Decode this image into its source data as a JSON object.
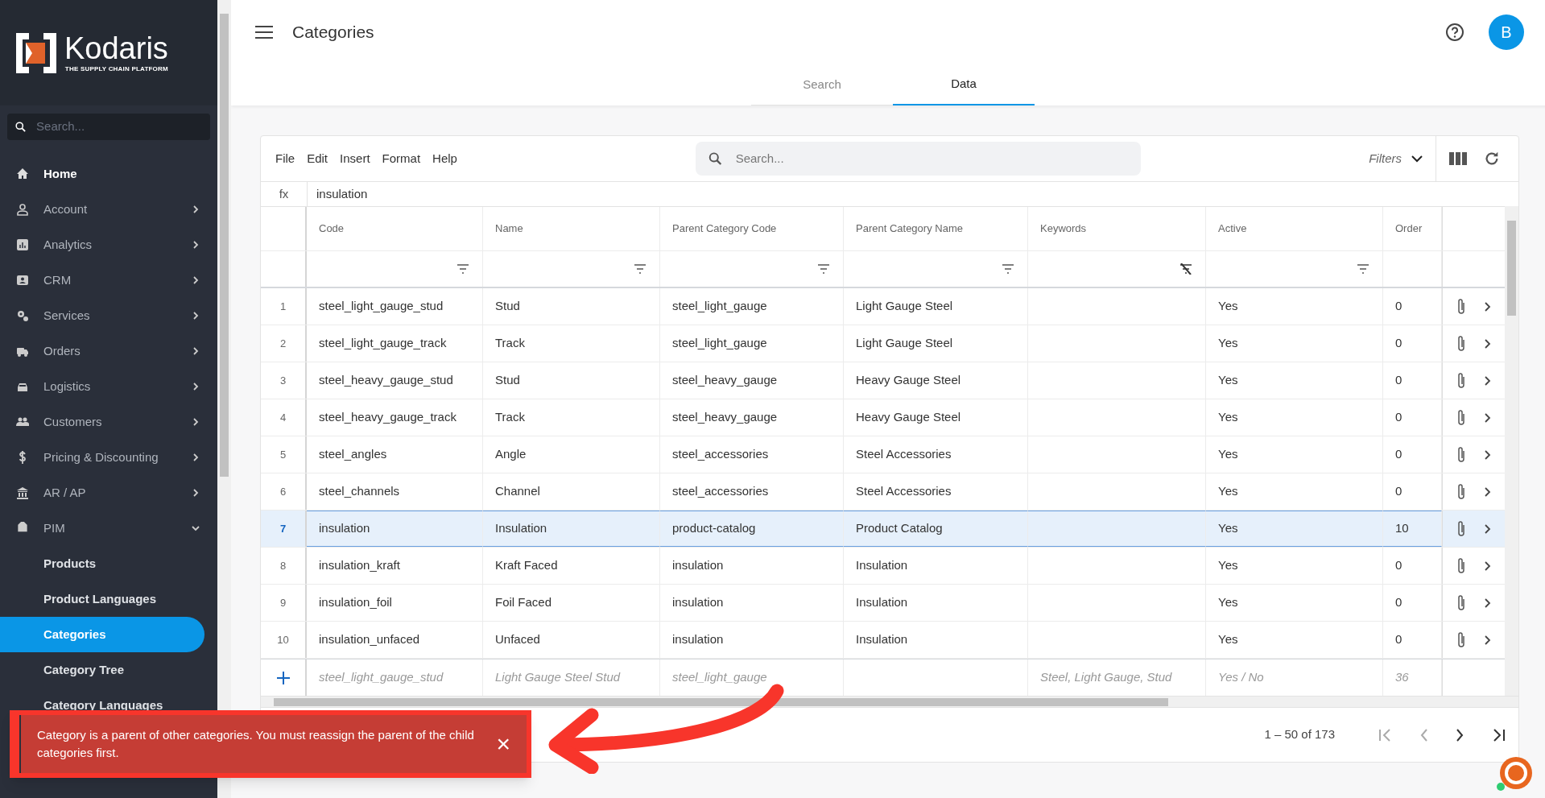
{
  "brand": {
    "name": "Kodaris",
    "tagline": "THE SUPPLY CHAIN PLATFORM"
  },
  "sidebar": {
    "search_placeholder": "Search...",
    "items": [
      {
        "label": "Home"
      },
      {
        "label": "Account",
        "expanded": false
      },
      {
        "label": "Analytics",
        "expanded": false
      },
      {
        "label": "CRM",
        "expanded": false
      },
      {
        "label": "Services",
        "expanded": false
      },
      {
        "label": "Orders",
        "expanded": false
      },
      {
        "label": "Logistics",
        "expanded": false
      },
      {
        "label": "Customers",
        "expanded": false
      },
      {
        "label": "Pricing & Discounting",
        "expanded": false
      },
      {
        "label": "AR / AP",
        "expanded": false
      },
      {
        "label": "PIM",
        "expanded": true,
        "children": [
          {
            "label": "Products",
            "selected": false
          },
          {
            "label": "Product Languages",
            "selected": false
          },
          {
            "label": "Categories",
            "selected": true
          },
          {
            "label": "Category Tree",
            "selected": false
          },
          {
            "label": "Category Languages",
            "selected": false
          }
        ]
      }
    ]
  },
  "header": {
    "title": "Categories",
    "avatar": "B"
  },
  "tabs": [
    {
      "label": "Search",
      "selected": false
    },
    {
      "label": "Data",
      "selected": true
    }
  ],
  "toolbar": {
    "menu": [
      "File",
      "Edit",
      "Insert",
      "Format",
      "Help"
    ],
    "search_placeholder": "Search...",
    "filters": "Filters"
  },
  "formula_bar": {
    "label": "fx",
    "value": "insulation"
  },
  "table": {
    "columns": [
      {
        "label": "Code",
        "filter_cleared": false
      },
      {
        "label": "Name",
        "filter_cleared": false
      },
      {
        "label": "Parent Category Code",
        "filter_cleared": false
      },
      {
        "label": "Parent Category Name",
        "filter_cleared": false
      },
      {
        "label": "Keywords",
        "filter_cleared": true
      },
      {
        "label": "Active",
        "filter_cleared": false
      },
      {
        "label": "Order"
      }
    ],
    "rows": [
      {
        "number": "1",
        "selected": false,
        "code": "steel_light_gauge_stud",
        "name": "Stud",
        "parent_code": "steel_light_gauge",
        "parent_name": "Light Gauge Steel",
        "active": "Yes",
        "order": "0"
      },
      {
        "number": "2",
        "selected": false,
        "code": "steel_light_gauge_track",
        "name": "Track",
        "parent_code": "steel_light_gauge",
        "parent_name": "Light Gauge Steel",
        "active": "Yes",
        "order": "0"
      },
      {
        "number": "3",
        "selected": false,
        "code": "steel_heavy_gauge_stud",
        "name": "Stud",
        "parent_code": "steel_heavy_gauge",
        "parent_name": "Heavy Gauge Steel",
        "active": "Yes",
        "order": "0"
      },
      {
        "number": "4",
        "selected": false,
        "code": "steel_heavy_gauge_track",
        "name": "Track",
        "parent_code": "steel_heavy_gauge",
        "parent_name": "Heavy Gauge Steel",
        "active": "Yes",
        "order": "0"
      },
      {
        "number": "5",
        "selected": false,
        "code": "steel_angles",
        "name": "Angle",
        "parent_code": "steel_accessories",
        "parent_name": "Steel Accessories",
        "active": "Yes",
        "order": "0"
      },
      {
        "number": "6",
        "selected": false,
        "code": "steel_channels",
        "name": "Channel",
        "parent_code": "steel_accessories",
        "parent_name": "Steel Accessories",
        "active": "Yes",
        "order": "0"
      },
      {
        "number": "7",
        "selected": true,
        "code": "insulation",
        "name": "Insulation",
        "parent_code": "product-catalog",
        "parent_name": "Product Catalog",
        "active": "Yes",
        "order": "10"
      },
      {
        "number": "8",
        "selected": false,
        "code": "insulation_kraft",
        "name": "Kraft Faced",
        "parent_code": "insulation",
        "parent_name": "Insulation",
        "active": "Yes",
        "order": "0"
      },
      {
        "number": "9",
        "selected": false,
        "code": "insulation_foil",
        "name": "Foil Faced",
        "parent_code": "insulation",
        "parent_name": "Insulation",
        "active": "Yes",
        "order": "0"
      },
      {
        "number": "10",
        "selected": false,
        "code": "insulation_unfaced",
        "name": "Unfaced",
        "parent_code": "insulation",
        "parent_name": "Insulation",
        "active": "Yes",
        "order": "0"
      }
    ],
    "new_row": {
      "code": "steel_light_gauge_stud",
      "name": "Light Gauge Steel Stud",
      "parent_code": "steel_light_gauge",
      "keywords": "Steel, Light Gauge, Stud",
      "active": "Yes / No",
      "order": "36"
    }
  },
  "pagination": {
    "range": "1 – 50 of 173"
  },
  "toast": {
    "message": "Category is a parent of other categories. You must reassign the parent of the child categories first.",
    "close": "×"
  }
}
